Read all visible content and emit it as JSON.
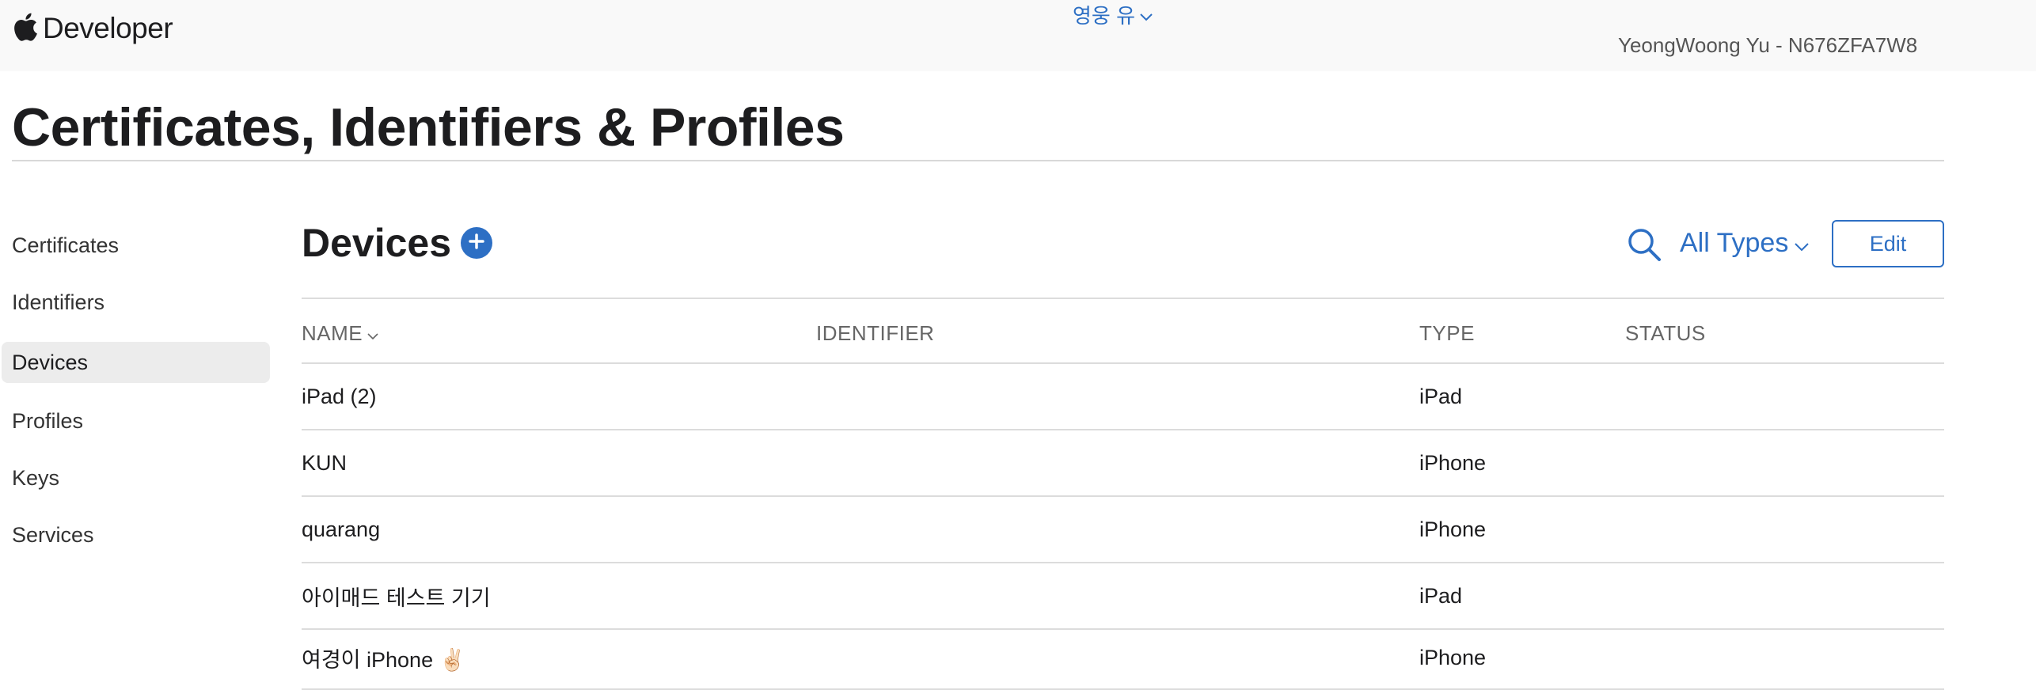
{
  "header": {
    "brand": "Developer",
    "account_name": "영웅 유",
    "team_line": "YeongWoong Yu - N676ZFA7W8"
  },
  "page": {
    "title": "Certificates, Identifiers & Profiles"
  },
  "sidebar": {
    "items": [
      {
        "label": "Certificates",
        "active": false
      },
      {
        "label": "Identifiers",
        "active": false
      },
      {
        "label": "Devices",
        "active": true
      },
      {
        "label": "Profiles",
        "active": false
      },
      {
        "label": "Keys",
        "active": false
      },
      {
        "label": "Services",
        "active": false
      }
    ]
  },
  "main": {
    "section_title": "Devices",
    "filter_label": "All Types",
    "edit_label": "Edit",
    "columns": {
      "name": "NAME",
      "identifier": "IDENTIFIER",
      "type": "TYPE",
      "status": "STATUS"
    },
    "rows": [
      {
        "name": "iPad (2)",
        "type": "iPad"
      },
      {
        "name": "KUN",
        "type": "iPhone"
      },
      {
        "name": "quarang",
        "type": "iPhone"
      },
      {
        "name": "아이매드 테스트 기기",
        "type": "iPad"
      },
      {
        "name": "여경이 iPhone ✌🏻",
        "type": "iPhone"
      }
    ]
  },
  "colors": {
    "accent": "#2d6fc4",
    "topbar_bg": "#f9f9f9",
    "active_item_bg": "#ececec"
  }
}
